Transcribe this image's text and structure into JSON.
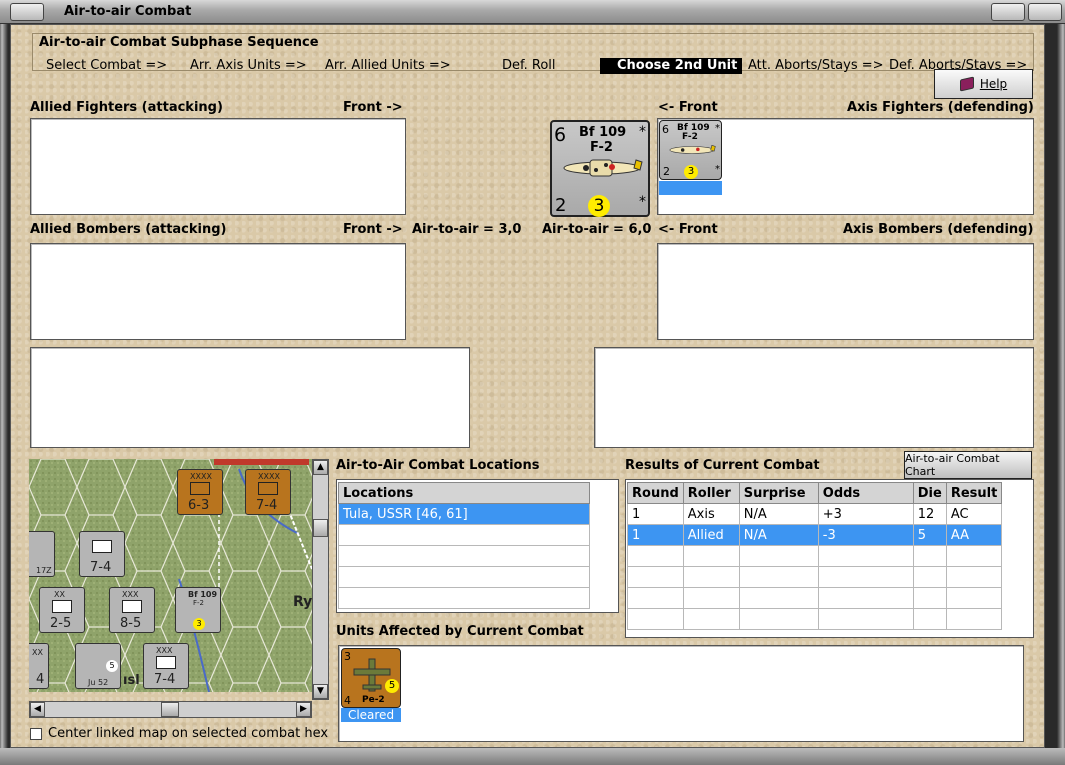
{
  "window": {
    "title": "Air-to-air Combat"
  },
  "subphase": {
    "title": "Air-to-air Combat Subphase Sequence",
    "steps": [
      "Select Combat =>",
      "Arr. Axis Units =>",
      "Arr. Allied Units  =>",
      "Def. Roll",
      "Choose 2nd Unit",
      "Att. Aborts/Stays =>",
      "Def. Aborts/Stays =>"
    ],
    "active_step": "Choose 2nd Unit"
  },
  "help": {
    "label": "Help"
  },
  "allied_fighters": {
    "title": "Allied Fighters (attacking)",
    "front": "Front ->"
  },
  "axis_fighters": {
    "title": "Axis Fighters (defending)",
    "front": "<- Front"
  },
  "allied_bombers": {
    "title": "Allied Bombers (attacking)",
    "front": "Front ->"
  },
  "axis_bombers": {
    "title": "Axis Bombers (defending)",
    "front": "<- Front"
  },
  "air_to_air": {
    "allied": "Air-to-air = 3,0",
    "axis": "Air-to-air = 6,0"
  },
  "selected_unit": {
    "name_line1": "Bf 109",
    "name_line2": "F-2",
    "attack": "6",
    "defense": "2",
    "range": "3",
    "star_top": "*",
    "star_bottom": "*"
  },
  "axis_fighter_unit": {
    "name_line1": "Bf 109",
    "name_line2": "F-2",
    "attack": "6",
    "defense": "2",
    "range": "3",
    "star_top": "*",
    "star_bottom": "*"
  },
  "locations": {
    "title": "Air-to-Air Combat Locations",
    "header": "Locations",
    "rows": [
      "Tula, USSR [46, 61]",
      "",
      "",
      "",
      ""
    ]
  },
  "results": {
    "title": "Results of Current Combat",
    "chart_button": "Air-to-air Combat Chart",
    "columns": [
      "Round",
      "Roller",
      "Surprise",
      "Odds",
      "Die",
      "Result"
    ],
    "rows": [
      [
        "1",
        "Axis",
        "N/A",
        "+3",
        "12",
        "AC"
      ],
      [
        "1",
        "Allied",
        "N/A",
        "-3",
        "5",
        "AA"
      ],
      [
        "",
        "",
        "",
        "",
        "",
        ""
      ],
      [
        "",
        "",
        "",
        "",
        "",
        ""
      ],
      [
        "",
        "",
        "",
        "",
        "",
        ""
      ],
      [
        "",
        "",
        "",
        "",
        "",
        ""
      ]
    ],
    "selected_row": 1
  },
  "affected": {
    "title": "Units Affected by Current Combat",
    "unit": {
      "name": "Pe-2",
      "top": "3",
      "bottom": "4",
      "range": "5",
      "status": "Cleared"
    }
  },
  "map": {
    "counters": [
      {
        "top": "3",
        "label": "6-3",
        "sub": "XXXX"
      },
      {
        "top": "3",
        "label": "7-4",
        "sub": "XXXX"
      },
      {
        "top": "",
        "label": "7-4",
        "sub": ""
      },
      {
        "top": "2",
        "label": "2-5",
        "sub": "XX"
      },
      {
        "top": "3",
        "label": "8-5",
        "sub": "XXX"
      },
      {
        "top": "5",
        "label": "Bf 109",
        "sub": "F-2"
      },
      {
        "top": "2",
        "label": "7-4",
        "sub": "XXX"
      },
      {
        "top": "2",
        "label": "Ju 52",
        "sub": ""
      }
    ],
    "place_fragment": "Ry",
    "place_fragment2": "ısl",
    "edge_label1": "17Z",
    "edge_label2": "4",
    "edge_label3": "XX"
  },
  "center_checkbox": {
    "label": "Center linked map on selected combat hex",
    "checked": false
  },
  "colors": {
    "parchment": "#dac9a8",
    "selection": "#3d95f2",
    "counter_axis": "#a9a9a9",
    "counter_soviet": "#b8741e",
    "range_circle": "#ffec00"
  }
}
